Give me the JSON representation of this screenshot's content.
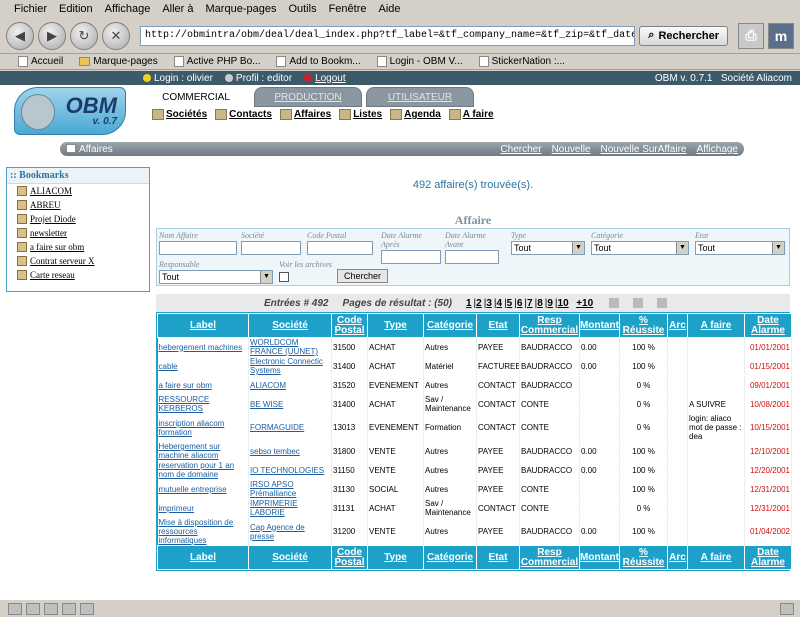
{
  "browser": {
    "menus": [
      "Fichier",
      "Edition",
      "Affichage",
      "Aller à",
      "Marque-pages",
      "Outils",
      "Fenêtre",
      "Aide"
    ],
    "url": "http://obmintra/obm/deal/deal_index.php?tf_label=&tf_company_name=&tf_zip=&tf_dateafter=&tf_datebefore=&",
    "search_button": "Rechercher",
    "bookmarks": [
      "Accueil",
      "Marque-pages",
      "Active PHP Bo...",
      "Add to Bookm...",
      "Login - OBM V...",
      "StickerNation :..."
    ]
  },
  "obm": {
    "login": "Login : olivier",
    "profil": "Profil : editor",
    "logout": "Logout",
    "version_right": "OBM v. 0.7.1",
    "company": "Société Aliacom",
    "logo_text": "OBM",
    "logo_version": "v. 0.7",
    "tabs": [
      "COMMERCIAL",
      "PRODUCTION",
      "UTILISATEUR"
    ],
    "subnav": [
      "Sociétés",
      "Contacts",
      "Affaires",
      "Listes",
      "Agenda",
      "A faire"
    ],
    "section_title": "Affaires",
    "section_actions": [
      "Chercher",
      "Nouvelle",
      "Nouvelle SurAffaire",
      "Affichage"
    ]
  },
  "bookmarks_panel": {
    "title": ":: Bookmarks",
    "items": [
      "ALIACOM",
      "ABREU",
      "Projet Diode",
      "newsletter",
      "a faire sur obm",
      "Contrat serveur X",
      "Carte reseau"
    ]
  },
  "search": {
    "found": "492 affaire(s) trouvée(s).",
    "form_title": "Affaire",
    "labels": {
      "nom": "Nom Affaire",
      "societe": "Société",
      "cp": "Code Postal",
      "date_apres": "Date Alarme Après",
      "date_avant": "Date Alarme Avant",
      "type": "Type",
      "categorie": "Catégorie",
      "etat": "Etat",
      "responsable": "Responsable",
      "archives": "Voir les archives"
    },
    "type_value": "Tout",
    "categorie_value": "Tout",
    "etat_value": "Tout",
    "responsable_value": "Tout",
    "button": "Chercher"
  },
  "pager": {
    "entries": "Entrées # 492",
    "pages_label": "Pages de résultat : (50)",
    "pages": [
      "1",
      "2",
      "3",
      "4",
      "5",
      "6",
      "7",
      "8",
      "9",
      "10",
      "+10"
    ]
  },
  "table": {
    "headers": [
      "Label",
      "Société",
      "Code Postal",
      "Type",
      "Catégorie",
      "Etat",
      "Resp Commercial",
      "Montant",
      "% Réussite",
      "Arc",
      "A faire",
      "Date Alarme"
    ],
    "rows": [
      [
        "hebergement machines",
        "WORLDCOM FRANCE (UUNET)",
        "31500",
        "ACHAT",
        "Autres",
        "PAYEE",
        "BAUDRACCO",
        "0.00",
        "100 %",
        "",
        "",
        "01/01/2001"
      ],
      [
        "cable",
        "Electronic Connectic Systems",
        "31400",
        "ACHAT",
        "Matériel",
        "FACTUREE",
        "BAUDRACCO",
        "0.00",
        "100 %",
        "",
        "",
        "01/15/2001"
      ],
      [
        "a faire sur obm",
        "ALIACOM",
        "31520",
        "EVENEMENT",
        "Autres",
        "CONTACT",
        "BAUDRACCO",
        "",
        "0 %",
        "",
        "",
        "09/01/2001"
      ],
      [
        "RESSOURCE KERBEROS",
        "BE WISE",
        "31400",
        "ACHAT",
        "Sav / Maintenance",
        "CONTACT",
        "CONTE",
        "",
        "0 %",
        "",
        "A SUIVRE",
        "10/08/2001"
      ],
      [
        "inscription aliacom formation",
        "FORMAGUIDE",
        "13013",
        "EVENEMENT",
        "Formation",
        "CONTACT",
        "CONTE",
        "",
        "0 %",
        "",
        "login: aliaco mot de passe : dea",
        "10/15/2001"
      ],
      [
        "Hebergement sur machine aliacom",
        "sebso tembec",
        "31800",
        "VENTE",
        "Autres",
        "PAYEE",
        "BAUDRACCO",
        "0.00",
        "100 %",
        "",
        "",
        "12/10/2001"
      ],
      [
        "reservation pour 1 an nom de domaine",
        "IO TECHNOLOGIES",
        "31150",
        "VENTE",
        "Autres",
        "PAYEE",
        "BAUDRACCO",
        "0.00",
        "100 %",
        "",
        "",
        "12/20/2001"
      ],
      [
        "mutuelle entreprise",
        "IRSO APSO Prémalliance",
        "31130",
        "SOCIAL",
        "Autres",
        "PAYEE",
        "CONTE",
        "",
        "100 %",
        "",
        "",
        "12/31/2001"
      ],
      [
        "imprimeur",
        "IMPRIMERIE LABORIE",
        "31131",
        "ACHAT",
        "Sav / Maintenance",
        "CONTACT",
        "CONTE",
        "",
        "0 %",
        "",
        "",
        "12/31/2001"
      ],
      [
        "Mise à disposition de ressources informatiques",
        "Cap Agence de presse",
        "31200",
        "VENTE",
        "Autres",
        "PAYEE",
        "BAUDRACCO",
        "0.00",
        "100 %",
        "",
        "",
        "01/04/2002"
      ]
    ]
  },
  "colors": {
    "table_header": "#1da1c8",
    "date_red": "#d01010",
    "link_blue": "#1b5fa0"
  }
}
